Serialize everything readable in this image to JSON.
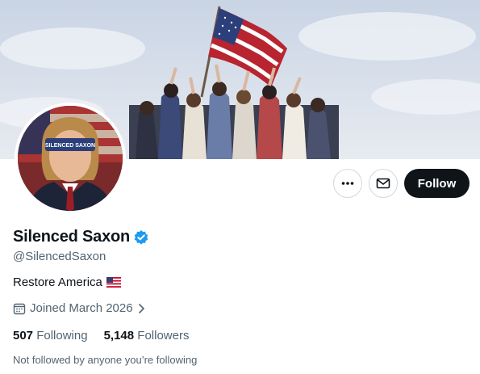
{
  "profile": {
    "display_name": "Silenced Saxon",
    "handle": "@SilencedSaxon",
    "bio": "Restore America",
    "bio_emoji": "us-flag-emoji",
    "joined": "Joined March 2026",
    "following_count": "507",
    "following_label": "Following",
    "followers_count": "5,148",
    "followers_label": "Followers",
    "followed_by_note": "Not followed by anyone you’re following",
    "avatar_blindfold_text": "SILENCED SAXON"
  },
  "actions": {
    "more": "more-icon",
    "message": "mail-icon",
    "follow_label": "Follow"
  },
  "colors": {
    "verified": "#1d9bf0",
    "follow_button_bg": "#0f1419",
    "secondary_text": "#536471"
  }
}
